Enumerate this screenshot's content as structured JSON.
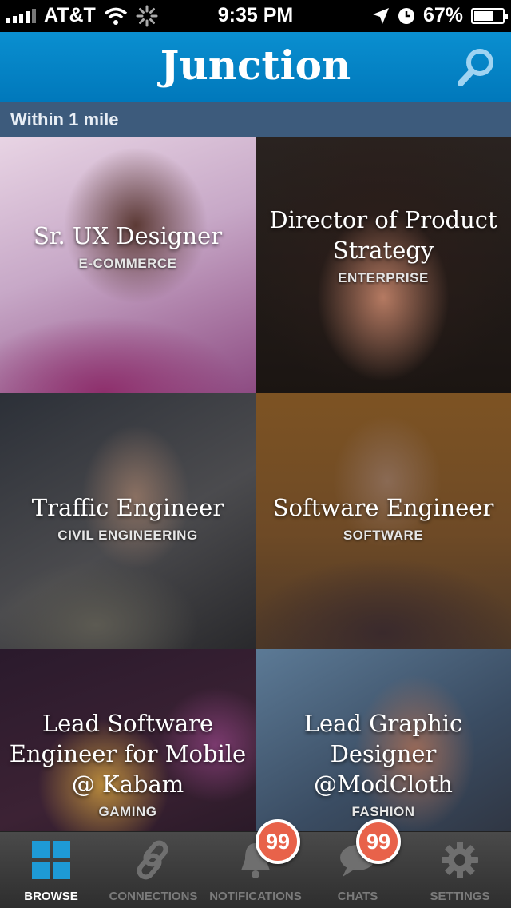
{
  "status_bar": {
    "carrier": "AT&T",
    "time": "9:35 PM",
    "battery": "67%",
    "battery_level": 0.67
  },
  "nav": {
    "title": "Junction",
    "search_icon": "search-icon"
  },
  "section": {
    "label": "Within 1 mile"
  },
  "tiles": [
    {
      "title": "Sr. UX Designer",
      "subtitle": "E-COMMERCE"
    },
    {
      "title": "Director of Product Strategy",
      "subtitle": "ENTERPRISE"
    },
    {
      "title": "Traffic Engineer",
      "subtitle": "CIVIL ENGINEERING"
    },
    {
      "title": "Software Engineer",
      "subtitle": "SOFTWARE"
    },
    {
      "title": "Lead Software Engineer for Mobile @ Kabam",
      "subtitle": "GAMING"
    },
    {
      "title": "Lead Graphic Designer @ModCloth",
      "subtitle": "FASHION"
    }
  ],
  "tabs": [
    {
      "label": "BROWSE",
      "icon": "grid-icon"
    },
    {
      "label": "CONNECTIONS",
      "icon": "link-icon"
    },
    {
      "label": "NOTIFICATIONS",
      "icon": "bell-icon",
      "badge": "99"
    },
    {
      "label": "CHATS",
      "icon": "chat-bubble-icon",
      "badge": "99"
    },
    {
      "label": "SETTINGS",
      "icon": "gear-icon"
    }
  ],
  "colors": {
    "nav": "#0a8fd0",
    "section": "#3d5b7c",
    "badge": "#e8624a",
    "active_tab_icon": "#1e9ad6"
  }
}
